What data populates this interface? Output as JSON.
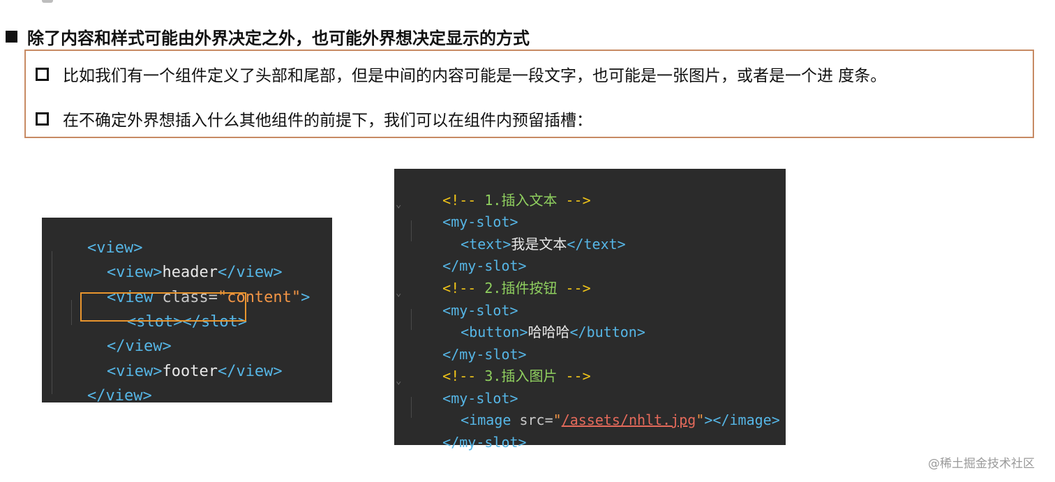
{
  "heading": "除了内容和样式可能由外界决定之外，也可能外界想决定显示的方式",
  "bullets": [
    "比如我们有一个组件定义了头部和尾部，但是中间的内容可能是一段文字，也可能是一张图片，或者是一个进 度条。",
    "在不确定外界想插入什么其他组件的前提下，我们可以在组件内预留插槽："
  ],
  "code_left": {
    "l1": "<view>",
    "l2_open": "<view>",
    "l2_text": "header",
    "l2_close": "</view>",
    "l3_open": "<view ",
    "l3_attr": "class=",
    "l3_str": "\"content\"",
    "l3_end": ">",
    "l4": "<slot></slot>",
    "l5": "</view>",
    "l6_open": "<view>",
    "l6_text": "footer",
    "l6_close": "</view>",
    "l7": "</view>"
  },
  "code_right": {
    "c1_open": "<!--",
    "c1_text": " 1.插入文本 ",
    "c1_close": "-->",
    "s1_open": "<my-slot>",
    "t_open": "<text>",
    "t_text": "我是文本",
    "t_close": "</text>",
    "s1_close": "</my-slot>",
    "c2_open": "<!--",
    "c2_text": " 2.插件按钮 ",
    "c2_close": "-->",
    "s2_open": "<my-slot>",
    "b_open": "<button>",
    "b_text": "哈哈哈",
    "b_close": "</button>",
    "s2_close": "</my-slot>",
    "c3_open": "<!--",
    "c3_text": " 3.插入图片 ",
    "c3_close": "-->",
    "s3_open": "<my-slot>",
    "i_open": "<image ",
    "i_attr": "src=",
    "i_q1": "\"",
    "i_path": "/assets/nhlt.jpg",
    "i_q2": "\"",
    "i_close": "></image>",
    "s3_close": "</my-slot>"
  },
  "watermark": "@稀土掘金技术社区",
  "colors": {
    "border": "#c78a63",
    "highlight": "#e8952e",
    "code_bg": "#2b2b2b",
    "tag": "#56b6e6",
    "comment": "#f0c419",
    "comment_text": "#8fcf5f"
  }
}
